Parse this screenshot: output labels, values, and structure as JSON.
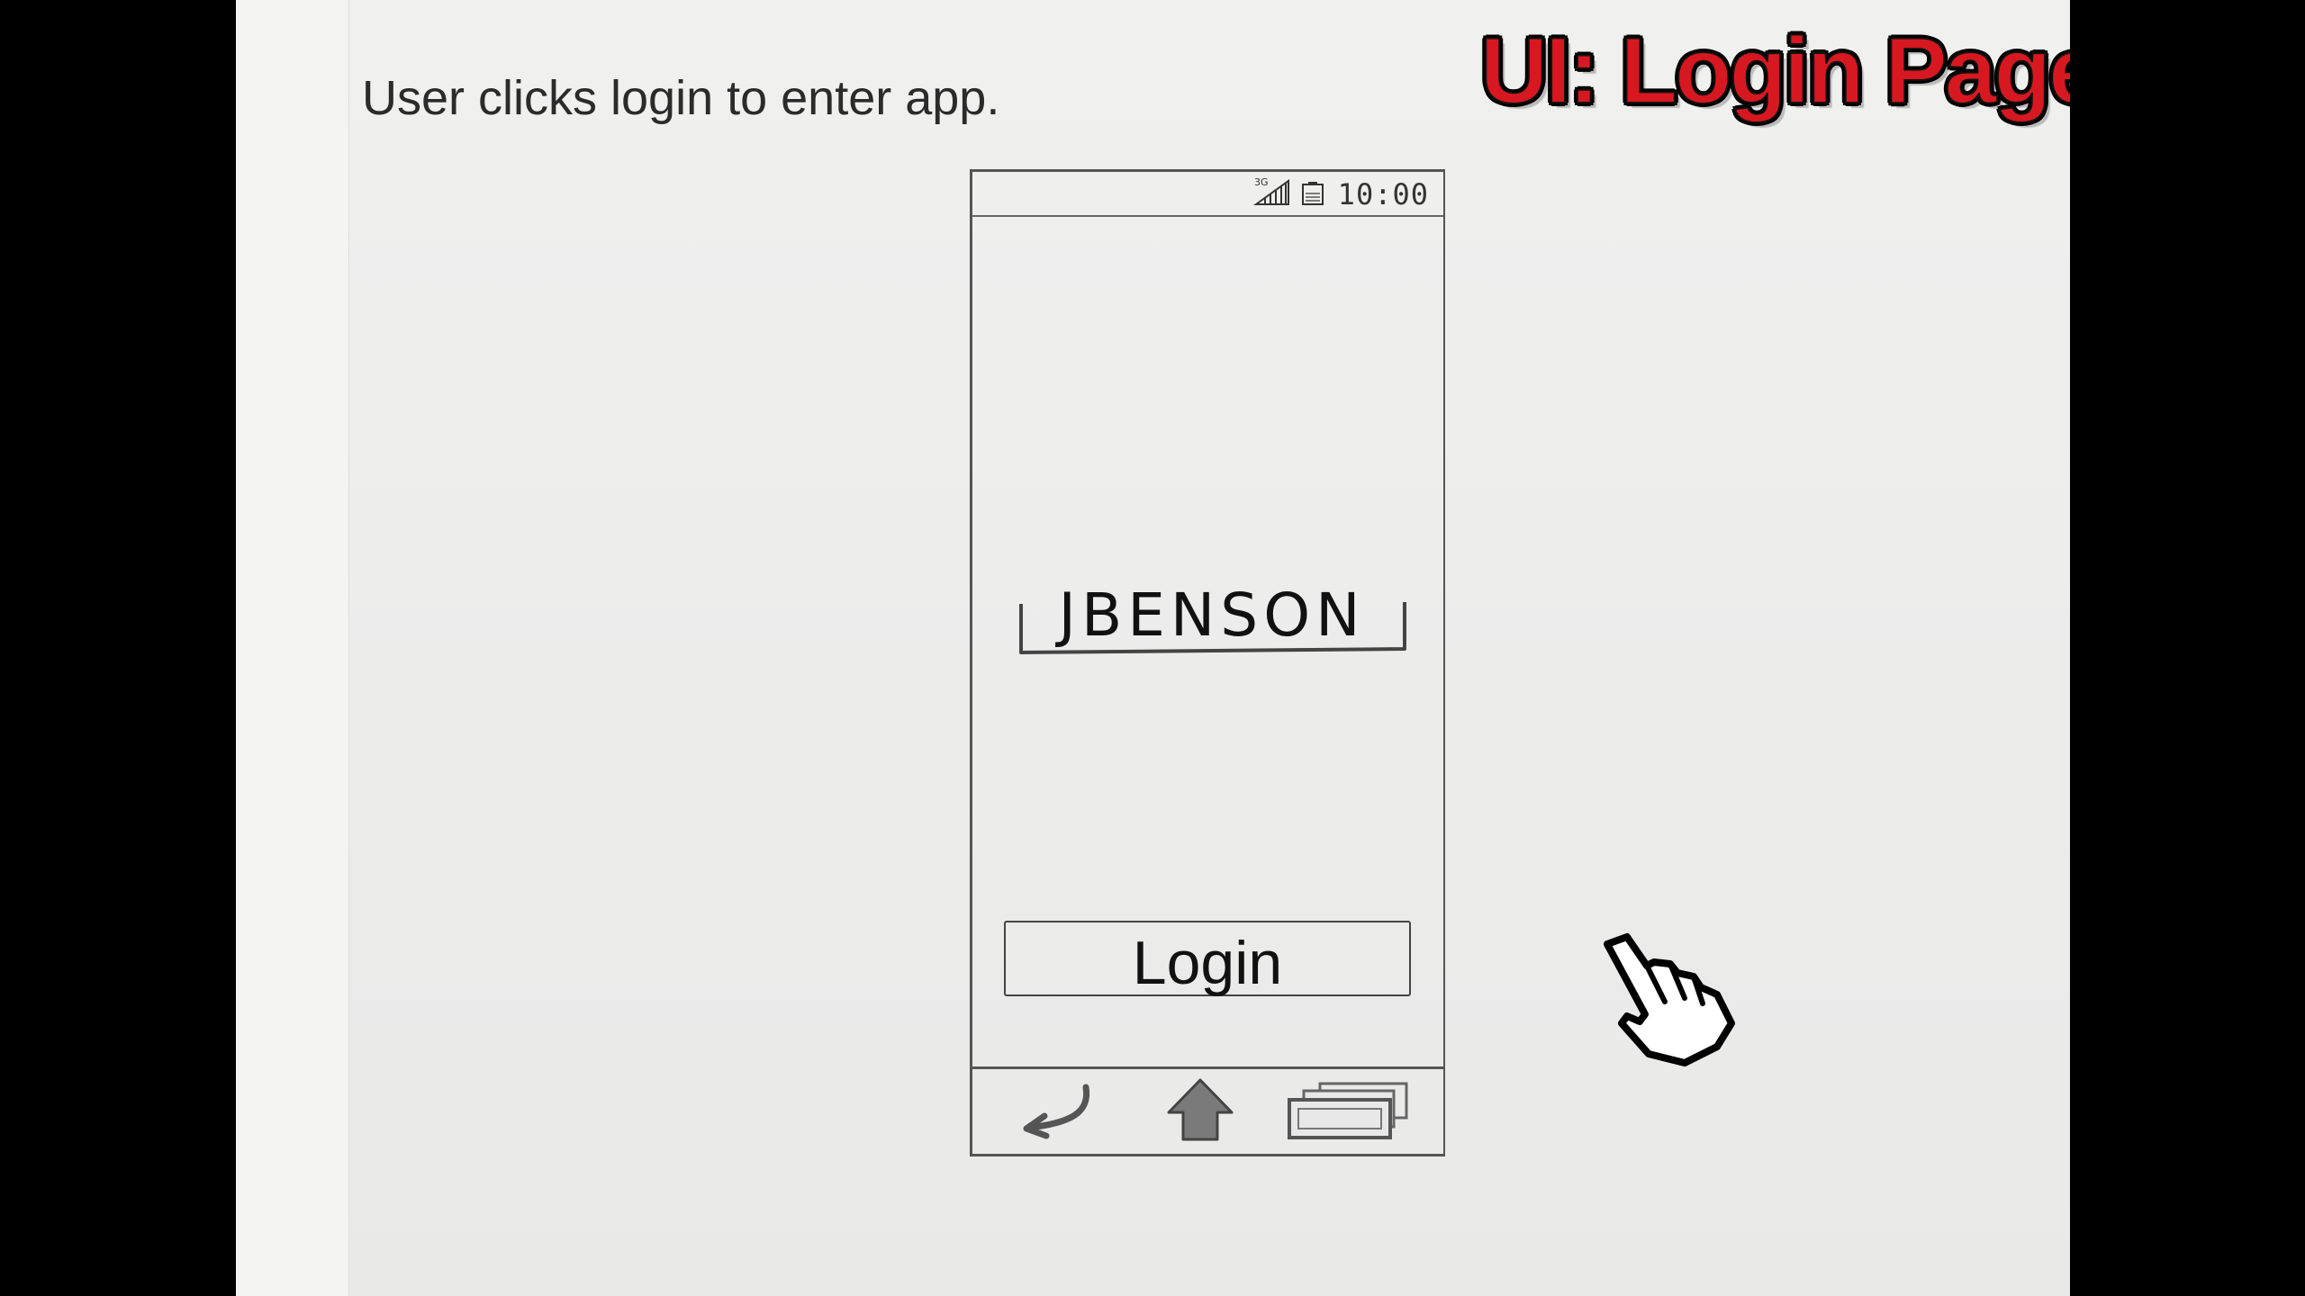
{
  "slide": {
    "caption": "User clicks login to enter app.",
    "title": "UI: Login Page"
  },
  "phone": {
    "status_bar": {
      "network_icon": "signal-3g-icon",
      "network_label": "3G",
      "battery_icon": "battery-icon",
      "time": "10:00"
    },
    "username": "JBENSON",
    "login_button_label": "Login",
    "nav_bar": {
      "back_icon": "back-arrow-icon",
      "home_icon": "home-arrow-icon",
      "recent_icon": "recent-apps-icon"
    }
  },
  "pointer": {
    "icon": "hand-pointer-icon"
  },
  "colors": {
    "title_red": "#d81820",
    "paper": "#ececeb",
    "background": "#000000"
  }
}
